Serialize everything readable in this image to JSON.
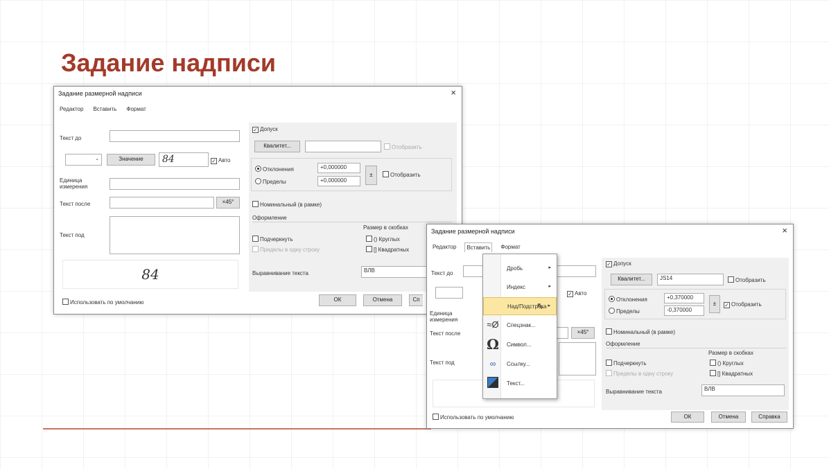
{
  "slide": {
    "title": "Задание надписи"
  },
  "dialog1": {
    "title": "Задание размерной надписи",
    "close": "×",
    "menu": [
      "Редактор",
      "Вставить",
      "Формат"
    ],
    "text_before_label": "Текст до",
    "value_button": "Значение",
    "value_field": "84",
    "auto_label": "Авто",
    "unit_label": "Единица измерения",
    "text_after_label": "Текст после",
    "x45_button": "×45°",
    "text_under_label": "Текст под",
    "preview_value": "84",
    "use_default_label": "Использовать по умолчанию",
    "tolerance_label": "Допуск",
    "qualitet_button": "Квалитет...",
    "show_label": "Отобразить",
    "deviations_label": "Отклонения",
    "limits_label": "Пределы",
    "upper_dev": "+0,000000",
    "lower_dev": "+0,000000",
    "pm_button": "±",
    "show2_label": "Отобразить",
    "nominal_label": "Номинальный (в рамке)",
    "design_label": "Оформление",
    "underline_label": "Подчеркнуть",
    "limits_one_line_label": "Пределы в одну строку",
    "brackets_label": "Размер в скобках",
    "round_label": "() Круглых",
    "square_label": "[] Квадратных",
    "align_label": "Выравнивание текста",
    "align_value": "ВЛВ",
    "ok_button": "ОК",
    "cancel_button": "Отмена",
    "help_button": "Сп"
  },
  "dialog2": {
    "title": "Задание размерной надписи",
    "close": "×",
    "menu": [
      "Редактор",
      "Вставить",
      "Формат"
    ],
    "text_before_label": "Текст до",
    "auto_label": "Авто",
    "unit_label": "Единица измерения",
    "text_after_label": "Текст после",
    "x45_button": "×45°",
    "text_under_label": "Текст под",
    "use_default_label": "Использовать по умолчанию",
    "tolerance_label": "Допуск",
    "qualitet_button": "Квалитет...",
    "qualitet_value": "JS14",
    "show_label": "Отобразить",
    "deviations_label": "Отклонения",
    "limits_label": "Пределы",
    "upper_dev": "+0,370000",
    "lower_dev": "-0,370000",
    "pm_button": "±",
    "show2_label": "Отобразить",
    "nominal_label": "Номинальный (в рамке)",
    "design_label": "Оформление",
    "underline_label": "Подчеркнуть",
    "limits_one_line_label": "Пределы в одну строку",
    "brackets_label": "Размер в скобках",
    "round_label": "() Круглых",
    "square_label": "[] Квадратных",
    "align_label": "Выравнивание текста",
    "align_value": "ВЛВ",
    "ok_button": "ОК",
    "cancel_button": "Отмена",
    "help_button": "Справка",
    "insert_menu": [
      {
        "label": "Дробь",
        "submenu": true,
        "icon": ""
      },
      {
        "label": "Индекс",
        "submenu": true,
        "icon": ""
      },
      {
        "label": "Над/Подстрока",
        "submenu": true,
        "icon": "",
        "highlighted": true
      },
      {
        "label": "Спецзнак...",
        "submenu": false,
        "icon": "special-char-icon"
      },
      {
        "label": "Символ...",
        "submenu": false,
        "icon": "omega-icon"
      },
      {
        "label": "Ссылку...",
        "submenu": false,
        "icon": "link-icon"
      },
      {
        "label": "Текст...",
        "submenu": false,
        "icon": "text-document-icon"
      }
    ]
  }
}
